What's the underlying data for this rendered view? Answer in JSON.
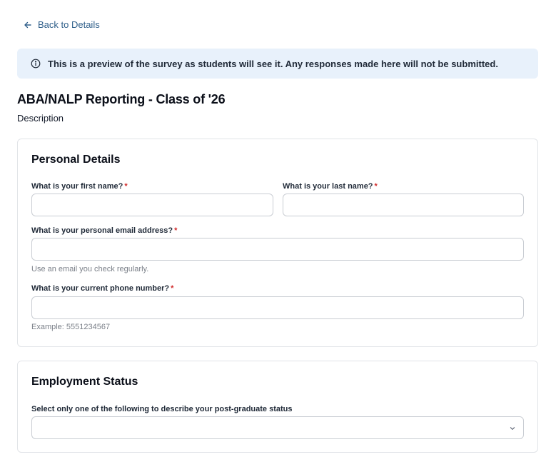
{
  "nav": {
    "back_label": "Back to Details"
  },
  "banner": {
    "text": "This is a preview of the survey as students will see it. Any responses made here will not be submitted."
  },
  "survey": {
    "title": "ABA/NALP Reporting - Class of '26",
    "description": "Description"
  },
  "personal": {
    "heading": "Personal Details",
    "first_name": {
      "label": "What is your first name?",
      "value": ""
    },
    "last_name": {
      "label": "What is your last name?",
      "value": ""
    },
    "email": {
      "label": "What is your personal email address?",
      "value": "",
      "hint": "Use an email you check regularly."
    },
    "phone": {
      "label": "What is your current phone number?",
      "value": "",
      "hint": "Example: 5551234567"
    },
    "required_marker": "*"
  },
  "employment": {
    "heading": "Employment Status",
    "status": {
      "label": "Select only one of the following to describe your post-graduate status",
      "selected": ""
    }
  },
  "colors": {
    "link": "#2f5f8a",
    "banner_bg": "#e8f1fb",
    "required": "#d12b2b",
    "border": "#c9cdd3"
  }
}
